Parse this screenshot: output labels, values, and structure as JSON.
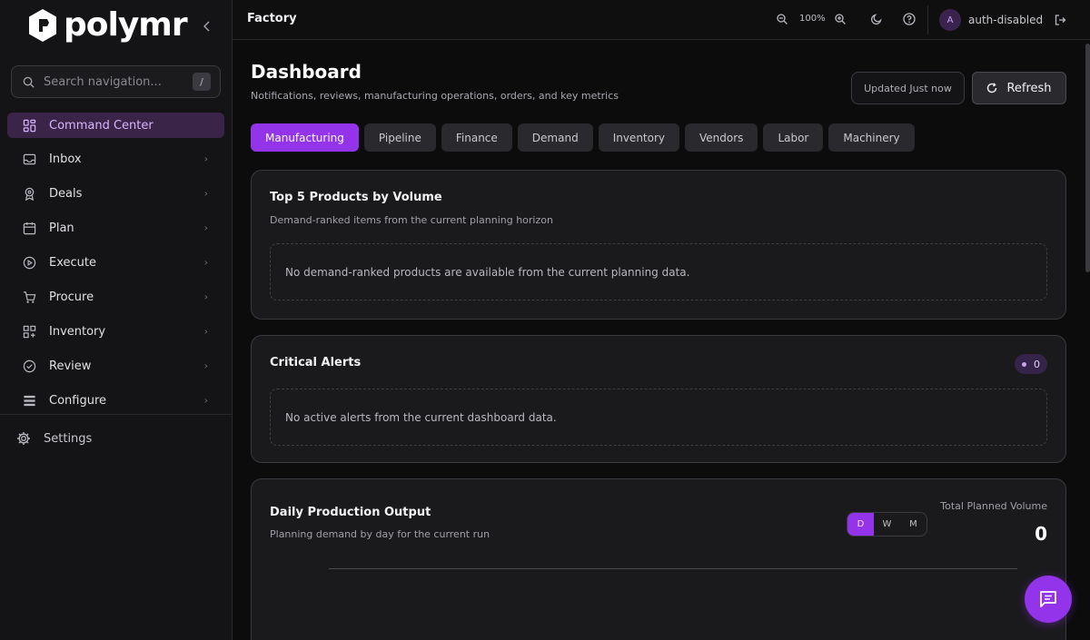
{
  "brand": {
    "name": "polymr"
  },
  "sidebar": {
    "search_placeholder": "Search navigation...",
    "search_shortcut": "/",
    "items": [
      {
        "label": "Command Center",
        "icon": "grid-icon",
        "active": true
      },
      {
        "label": "Inbox",
        "icon": "inbox-icon"
      },
      {
        "label": "Deals",
        "icon": "award-icon"
      },
      {
        "label": "Plan",
        "icon": "calendar-icon"
      },
      {
        "label": "Execute",
        "icon": "play-circle-icon"
      },
      {
        "label": "Procure",
        "icon": "cart-icon"
      },
      {
        "label": "Inventory",
        "icon": "boxes-icon"
      },
      {
        "label": "Review",
        "icon": "check-circle-icon"
      },
      {
        "label": "Configure",
        "icon": "list-icon"
      }
    ],
    "settings_label": "Settings"
  },
  "topbar": {
    "title": "Factory",
    "zoom_level": "100%",
    "avatar_initial": "A",
    "user": "auth-disabled"
  },
  "page": {
    "title": "Dashboard",
    "subtitle": "Notifications, reviews, manufacturing operations, orders, and key metrics",
    "updated_label": "Updated Just now",
    "refresh_label": "Refresh"
  },
  "tabs": [
    {
      "label": "Manufacturing",
      "active": true
    },
    {
      "label": "Pipeline"
    },
    {
      "label": "Finance"
    },
    {
      "label": "Demand"
    },
    {
      "label": "Inventory"
    },
    {
      "label": "Vendors"
    },
    {
      "label": "Labor"
    },
    {
      "label": "Machinery"
    }
  ],
  "cards": {
    "top_products": {
      "title": "Top 5 Products by Volume",
      "subtitle": "Demand-ranked items from the current planning horizon",
      "empty": "No demand-ranked products are available from the current planning data."
    },
    "critical_alerts": {
      "title": "Critical Alerts",
      "count": "0",
      "empty": "No active alerts from the current dashboard data."
    },
    "daily_output": {
      "title": "Daily Production Output",
      "subtitle": "Planning demand by day for the current run",
      "periods": [
        "D",
        "W",
        "M"
      ],
      "active_period": "D",
      "total_label": "Total Planned Volume",
      "total_value": "0"
    }
  },
  "colors": {
    "accent": "#9333ea",
    "active_nav_bg": "#3a2548",
    "background": "#0c0c0d",
    "card_bg": "#1a1a1c"
  }
}
